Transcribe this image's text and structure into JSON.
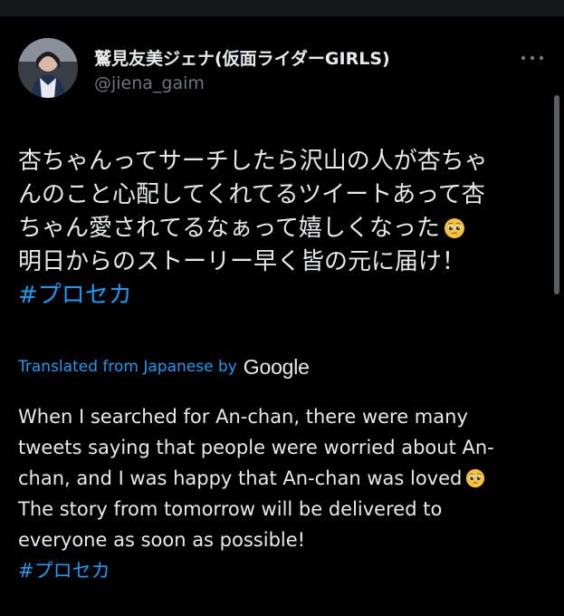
{
  "author": {
    "display_name": "鷲見友美ジェナ(仮面ライダーGIRLS)",
    "handle": "@jiena_gaim"
  },
  "tweet": {
    "lines": [
      "杏ちゃんってサーチしたら沢山の人が杏ちゃ",
      "んのこと心配してくれてるツイートあって杏",
      "ちゃん愛されてるなぁって嬉しくなった",
      "明日からのストーリー早く皆の元に届け！"
    ],
    "emoji": "pleading-face",
    "hashtag": "#プロセカ"
  },
  "translation": {
    "label": "Translated from Japanese by",
    "provider": "Google",
    "lines": [
      "When I searched for An-chan, there were many",
      "tweets saying that people were worried about An-",
      "chan, and I was happy that An-chan was loved",
      "The story from tomorrow will be delivered to",
      "everyone as soon as possible!"
    ],
    "hashtag": "#プロセカ"
  },
  "colors": {
    "background": "#000000",
    "text": "#e7e9ea",
    "muted": "#71767b",
    "accent": "#1d9bf0"
  },
  "icons": {
    "more": "more-dots-icon",
    "emoji": "pleading-face-emoji"
  }
}
